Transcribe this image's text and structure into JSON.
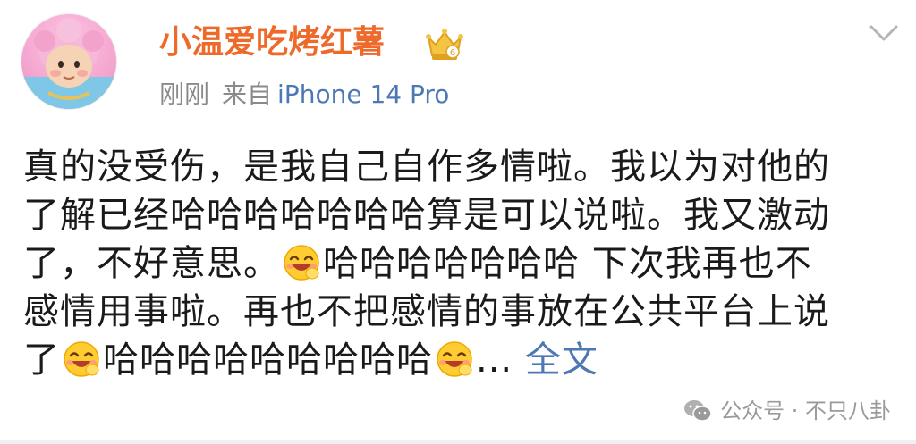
{
  "post": {
    "username": "小温爱吃烤红薯",
    "time": "刚刚",
    "from_label": "来自",
    "device": "iPhone 14 Pro",
    "lines": {
      "l1": "真的没受伤，是我自己自作多情啦。我以为对他的",
      "l2": "了解已经哈哈哈哈哈哈哈算是可以说啦。我又激动",
      "l3a": "了，不好意思。",
      "l3b": "哈哈哈哈哈哈哈 下次我再也不",
      "l4": "感情用事啦。再也不把感情的事放在公共平台上说",
      "l5a": "了",
      "l5b": "哈哈哈哈哈哈哈哈哈",
      "l5c": "...",
      "more": "全文"
    }
  },
  "icons": {
    "avatar": "cartoon-girl-avatar",
    "vip_badge": "crown-badge-icon",
    "chevron": "chevron-down-icon",
    "emoji": "laughing-emoji-icon",
    "watermark": "wechat-icon"
  },
  "watermark": {
    "text": "公众号 · 不只八卦"
  },
  "colors": {
    "username": "#ee6a2b",
    "meta": "#8a8a8a",
    "link": "#4d78b4",
    "text": "#1a1a1a"
  }
}
